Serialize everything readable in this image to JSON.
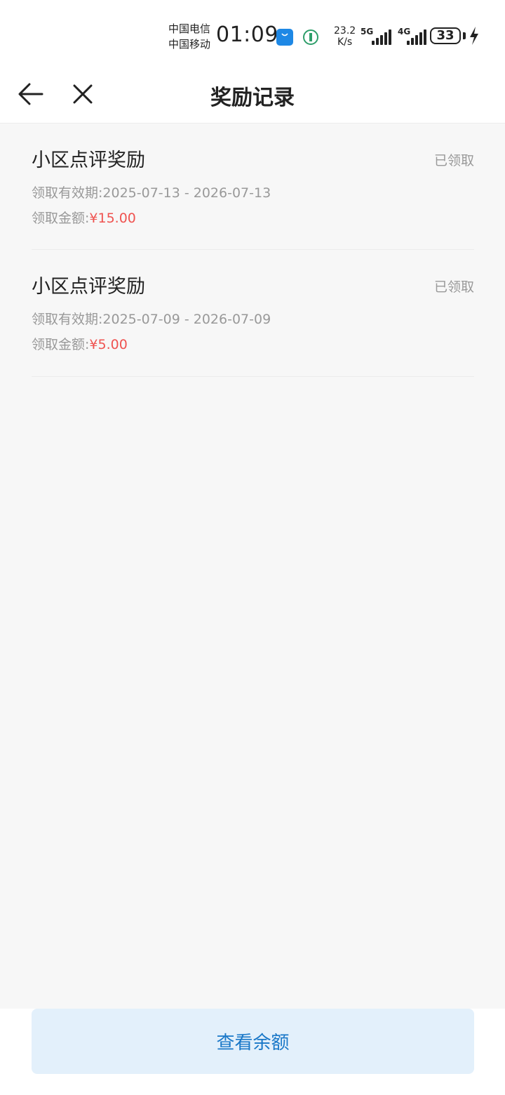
{
  "status_bar": {
    "carrier_1": "中国电信",
    "carrier_2": "中国移动",
    "time": "01:09",
    "speed_value": "23.2",
    "speed_unit": "K/s",
    "network_1": "5G",
    "network_2": "4G",
    "battery": "33"
  },
  "header": {
    "title": "奖励记录"
  },
  "records": [
    {
      "title": "小区点评奖励",
      "status": "已领取",
      "validity_label": "领取有效期:",
      "validity": "2025-07-13 - 2026-07-13",
      "amount_label": "领取金额:",
      "amount": "¥15.00"
    },
    {
      "title": "小区点评奖励",
      "status": "已领取",
      "validity_label": "领取有效期:",
      "validity": "2025-07-09 - 2026-07-09",
      "amount_label": "领取金额:",
      "amount": "¥5.00"
    }
  ],
  "footer": {
    "balance_button": "查看余额"
  },
  "colors": {
    "accent": "#1a78c8",
    "amount": "#ef5350",
    "button_bg": "#e3f0fb"
  }
}
